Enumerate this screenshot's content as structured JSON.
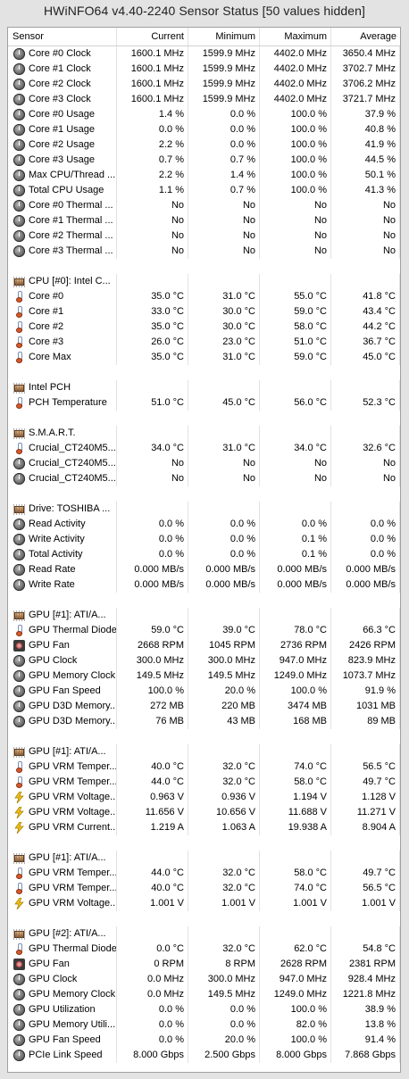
{
  "window": {
    "title": "HWiNFO64 v4.40-2240 Sensor Status [50 values hidden]"
  },
  "columns": [
    "Sensor",
    "Current",
    "Minimum",
    "Maximum",
    "Average"
  ],
  "rows": [
    {
      "icon": "clock-icon",
      "label": "Core #0 Clock",
      "v": [
        "1600.1 MHz",
        "1599.9 MHz",
        "4402.0 MHz",
        "3650.4 MHz"
      ]
    },
    {
      "icon": "clock-icon",
      "label": "Core #1 Clock",
      "v": [
        "1600.1 MHz",
        "1599.9 MHz",
        "4402.0 MHz",
        "3702.7 MHz"
      ]
    },
    {
      "icon": "clock-icon",
      "label": "Core #2 Clock",
      "v": [
        "1600.1 MHz",
        "1599.9 MHz",
        "4402.0 MHz",
        "3706.2 MHz"
      ]
    },
    {
      "icon": "clock-icon",
      "label": "Core #3 Clock",
      "v": [
        "1600.1 MHz",
        "1599.9 MHz",
        "4402.0 MHz",
        "3721.7 MHz"
      ]
    },
    {
      "icon": "clock-icon",
      "label": "Core #0 Usage",
      "v": [
        "1.4 %",
        "0.0 %",
        "100.0 %",
        "37.9 %"
      ]
    },
    {
      "icon": "clock-icon",
      "label": "Core #1 Usage",
      "v": [
        "0.0 %",
        "0.0 %",
        "100.0 %",
        "40.8 %"
      ]
    },
    {
      "icon": "clock-icon",
      "label": "Core #2 Usage",
      "v": [
        "2.2 %",
        "0.0 %",
        "100.0 %",
        "41.9 %"
      ]
    },
    {
      "icon": "clock-icon",
      "label": "Core #3 Usage",
      "v": [
        "0.7 %",
        "0.7 %",
        "100.0 %",
        "44.5 %"
      ]
    },
    {
      "icon": "clock-icon",
      "label": "Max CPU/Thread ...",
      "v": [
        "2.2 %",
        "1.4 %",
        "100.0 %",
        "50.1 %"
      ]
    },
    {
      "icon": "clock-icon",
      "label": "Total CPU Usage",
      "v": [
        "1.1 %",
        "0.7 %",
        "100.0 %",
        "41.3 %"
      ]
    },
    {
      "icon": "clock-icon",
      "label": "Core #0 Thermal ...",
      "v": [
        "No",
        "No",
        "No",
        "No"
      ]
    },
    {
      "icon": "clock-icon",
      "label": "Core #1 Thermal ...",
      "v": [
        "No",
        "No",
        "No",
        "No"
      ]
    },
    {
      "icon": "clock-icon",
      "label": "Core #2 Thermal ...",
      "v": [
        "No",
        "No",
        "No",
        "No"
      ]
    },
    {
      "icon": "clock-icon",
      "label": "Core #3 Thermal ...",
      "v": [
        "No",
        "No",
        "No",
        "No"
      ]
    },
    {
      "empty": true
    },
    {
      "icon": "chip-icon",
      "label": "CPU [#0]: Intel C...",
      "group": true,
      "v": [
        "",
        "",
        "",
        ""
      ]
    },
    {
      "icon": "thermometer-icon",
      "label": "Core #0",
      "v": [
        "35.0 °C",
        "31.0 °C",
        "55.0 °C",
        "41.8 °C"
      ]
    },
    {
      "icon": "thermometer-icon",
      "label": "Core #1",
      "v": [
        "33.0 °C",
        "30.0 °C",
        "59.0 °C",
        "43.4 °C"
      ]
    },
    {
      "icon": "thermometer-icon",
      "label": "Core #2",
      "v": [
        "35.0 °C",
        "30.0 °C",
        "58.0 °C",
        "44.2 °C"
      ]
    },
    {
      "icon": "thermometer-icon",
      "label": "Core #3",
      "v": [
        "26.0 °C",
        "23.0 °C",
        "51.0 °C",
        "36.7 °C"
      ]
    },
    {
      "icon": "thermometer-icon",
      "label": "Core Max",
      "v": [
        "35.0 °C",
        "31.0 °C",
        "59.0 °C",
        "45.0 °C"
      ]
    },
    {
      "empty": true
    },
    {
      "icon": "chip-icon",
      "label": "Intel PCH",
      "group": true,
      "v": [
        "",
        "",
        "",
        ""
      ]
    },
    {
      "icon": "thermometer-icon",
      "label": "PCH Temperature",
      "v": [
        "51.0 °C",
        "45.0 °C",
        "56.0 °C",
        "52.3 °C"
      ]
    },
    {
      "empty": true
    },
    {
      "icon": "chip-icon",
      "label": "S.M.A.R.T.",
      "group": true,
      "v": [
        "",
        "",
        "",
        ""
      ]
    },
    {
      "icon": "thermometer-icon",
      "label": "Crucial_CT240M5...",
      "v": [
        "34.0 °C",
        "31.0 °C",
        "34.0 °C",
        "32.6 °C"
      ]
    },
    {
      "icon": "clock-icon",
      "label": "Crucial_CT240M5...",
      "v": [
        "No",
        "No",
        "No",
        "No"
      ]
    },
    {
      "icon": "clock-icon",
      "label": "Crucial_CT240M5...",
      "v": [
        "No",
        "No",
        "No",
        "No"
      ]
    },
    {
      "empty": true
    },
    {
      "icon": "chip-icon",
      "label": "Drive: TOSHIBA ...",
      "group": true,
      "v": [
        "",
        "",
        "",
        ""
      ]
    },
    {
      "icon": "clock-icon",
      "label": "Read Activity",
      "v": [
        "0.0 %",
        "0.0 %",
        "0.0 %",
        "0.0 %"
      ]
    },
    {
      "icon": "clock-icon",
      "label": "Write Activity",
      "v": [
        "0.0 %",
        "0.0 %",
        "0.1 %",
        "0.0 %"
      ]
    },
    {
      "icon": "clock-icon",
      "label": "Total Activity",
      "v": [
        "0.0 %",
        "0.0 %",
        "0.1 %",
        "0.0 %"
      ]
    },
    {
      "icon": "clock-icon",
      "label": "Read Rate",
      "v": [
        "0.000 MB/s",
        "0.000 MB/s",
        "0.000 MB/s",
        "0.000 MB/s"
      ]
    },
    {
      "icon": "clock-icon",
      "label": "Write Rate",
      "v": [
        "0.000 MB/s",
        "0.000 MB/s",
        "0.000 MB/s",
        "0.000 MB/s"
      ]
    },
    {
      "empty": true
    },
    {
      "icon": "chip-icon",
      "label": "GPU [#1]: ATI/A...",
      "group": true,
      "v": [
        "",
        "",
        "",
        ""
      ]
    },
    {
      "icon": "thermometer-icon",
      "label": "GPU Thermal Diode",
      "v": [
        "59.0 °C",
        "39.0 °C",
        "78.0 °C",
        "66.3 °C"
      ]
    },
    {
      "icon": "fan-icon",
      "label": "GPU Fan",
      "v": [
        "2668 RPM",
        "1045 RPM",
        "2736 RPM",
        "2426 RPM"
      ]
    },
    {
      "icon": "clock-icon",
      "label": "GPU Clock",
      "v": [
        "300.0 MHz",
        "300.0 MHz",
        "947.0 MHz",
        "823.9 MHz"
      ]
    },
    {
      "icon": "clock-icon",
      "label": "GPU Memory Clock",
      "v": [
        "149.5 MHz",
        "149.5 MHz",
        "1249.0 MHz",
        "1073.7 MHz"
      ]
    },
    {
      "icon": "clock-icon",
      "label": "GPU Fan Speed",
      "v": [
        "100.0 %",
        "20.0 %",
        "100.0 %",
        "91.9 %"
      ]
    },
    {
      "icon": "clock-icon",
      "label": "GPU D3D Memory...",
      "v": [
        "272 MB",
        "220 MB",
        "3474 MB",
        "1031 MB"
      ]
    },
    {
      "icon": "clock-icon",
      "label": "GPU D3D Memory...",
      "v": [
        "76 MB",
        "43 MB",
        "168 MB",
        "89 MB"
      ]
    },
    {
      "empty": true
    },
    {
      "icon": "chip-icon",
      "label": "GPU [#1]: ATI/A...",
      "group": true,
      "v": [
        "",
        "",
        "",
        ""
      ]
    },
    {
      "icon": "thermometer-icon",
      "label": "GPU VRM Temper...",
      "v": [
        "40.0 °C",
        "32.0 °C",
        "74.0 °C",
        "56.5 °C"
      ]
    },
    {
      "icon": "thermometer-icon",
      "label": "GPU VRM Temper...",
      "v": [
        "44.0 °C",
        "32.0 °C",
        "58.0 °C",
        "49.7 °C"
      ]
    },
    {
      "icon": "bolt-icon",
      "label": "GPU VRM Voltage...",
      "v": [
        "0.963 V",
        "0.936 V",
        "1.194 V",
        "1.128 V"
      ]
    },
    {
      "icon": "bolt-icon",
      "label": "GPU VRM Voltage...",
      "v": [
        "11.656 V",
        "10.656 V",
        "11.688 V",
        "11.271 V"
      ]
    },
    {
      "icon": "bolt-icon",
      "label": "GPU VRM Current...",
      "v": [
        "1.219 A",
        "1.063 A",
        "19.938 A",
        "8.904 A"
      ]
    },
    {
      "empty": true
    },
    {
      "icon": "chip-icon",
      "label": "GPU [#1]: ATI/A...",
      "group": true,
      "v": [
        "",
        "",
        "",
        ""
      ]
    },
    {
      "icon": "thermometer-icon",
      "label": "GPU VRM Temper...",
      "v": [
        "44.0 °C",
        "32.0 °C",
        "58.0 °C",
        "49.7 °C"
      ]
    },
    {
      "icon": "thermometer-icon",
      "label": "GPU VRM Temper...",
      "v": [
        "40.0 °C",
        "32.0 °C",
        "74.0 °C",
        "56.5 °C"
      ]
    },
    {
      "icon": "bolt-icon",
      "label": "GPU VRM Voltage...",
      "v": [
        "1.001 V",
        "1.001 V",
        "1.001 V",
        "1.001 V"
      ]
    },
    {
      "empty": true
    },
    {
      "icon": "chip-icon",
      "label": "GPU [#2]: ATI/A...",
      "group": true,
      "v": [
        "",
        "",
        "",
        ""
      ]
    },
    {
      "icon": "thermometer-icon",
      "label": "GPU Thermal Diode",
      "v": [
        "0.0 °C",
        "32.0 °C",
        "62.0 °C",
        "54.8 °C"
      ]
    },
    {
      "icon": "fan-icon",
      "label": "GPU Fan",
      "v": [
        "0 RPM",
        "8 RPM",
        "2628 RPM",
        "2381 RPM"
      ]
    },
    {
      "icon": "clock-icon",
      "label": "GPU Clock",
      "v": [
        "0.0 MHz",
        "300.0 MHz",
        "947.0 MHz",
        "928.4 MHz"
      ]
    },
    {
      "icon": "clock-icon",
      "label": "GPU Memory Clock",
      "v": [
        "0.0 MHz",
        "149.5 MHz",
        "1249.0 MHz",
        "1221.8 MHz"
      ]
    },
    {
      "icon": "clock-icon",
      "label": "GPU Utilization",
      "v": [
        "0.0 %",
        "0.0 %",
        "100.0 %",
        "38.9 %"
      ]
    },
    {
      "icon": "clock-icon",
      "label": "GPU Memory Utili...",
      "v": [
        "0.0 %",
        "0.0 %",
        "82.0 %",
        "13.8 %"
      ]
    },
    {
      "icon": "clock-icon",
      "label": "GPU Fan Speed",
      "v": [
        "0.0 %",
        "20.0 %",
        "100.0 %",
        "91.4 %"
      ]
    },
    {
      "icon": "clock-icon",
      "label": "PCIe Link Speed",
      "v": [
        "8.000 Gbps",
        "2.500 Gbps",
        "8.000 Gbps",
        "7.868 Gbps"
      ]
    }
  ]
}
